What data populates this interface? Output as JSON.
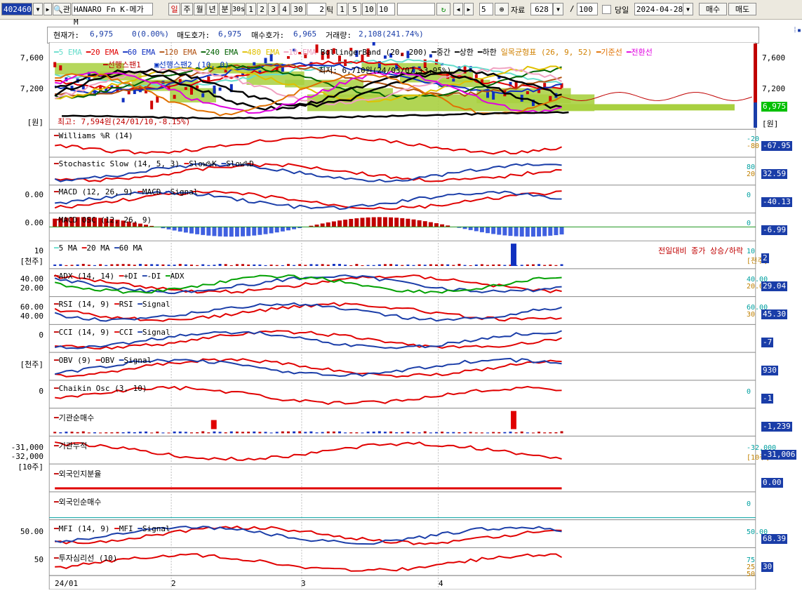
{
  "toolbar": {
    "code": "402460",
    "ticker_name": "HANARO Fn K-메가 M",
    "periods": [
      "일",
      "주",
      "월",
      "년",
      "분",
      "30s"
    ],
    "minute_steps": [
      "1",
      "2",
      "3",
      "4",
      "30"
    ],
    "tick_input": "2",
    "tick_label": "틱",
    "tick_steps": [
      "1",
      "5",
      "10",
      "10"
    ],
    "count_value": "5",
    "data_label": "자료",
    "data_count": "628",
    "ratio": "100",
    "ratio_sep": "/",
    "same_day_label": "당일",
    "date": "2024-04-28",
    "buy_label": "매수",
    "sell_label": "매도"
  },
  "info": {
    "current_label": "현재가:",
    "current": "6,975",
    "change": "0(0.00%)",
    "ask_label": "매도호가:",
    "ask": "6,975",
    "bid_label": "매수호가:",
    "bid": "6,965",
    "volume_label": "거래량:",
    "volume": "2,108(241.74%)"
  },
  "price_panel": {
    "legend": [
      {
        "text": "5 EMA",
        "color": "#66ddcc"
      },
      {
        "text": "20 EMA",
        "color": "#e00000"
      },
      {
        "text": "60 EMA",
        "color": "#1030c0"
      },
      {
        "text": "120 EMA",
        "color": "#b05010"
      },
      {
        "text": "240 EMA",
        "color": "#006000"
      },
      {
        "text": "480 EMA",
        "color": "#e0c000"
      },
      {
        "text": "10 EMA",
        "color": "#f0a0c0"
      },
      {
        "text": "BollingerBand (20, 200)",
        "color": "#000000"
      },
      {
        "text": "중간",
        "color": "#000000"
      },
      {
        "text": "상한",
        "color": "#000000"
      },
      {
        "text": "하한",
        "color": "#000000"
      },
      {
        "text": "일목균형표 (26, 9, 52)",
        "color": "#d08000"
      },
      {
        "text": "기준선",
        "color": "#e07000"
      },
      {
        "text": "전환선",
        "color": "#e000e0"
      }
    ],
    "legend2": [
      {
        "text": "선행스팬1",
        "color": "#c00000"
      },
      {
        "text": "선행스팬2",
        "color": "#0030c0"
      },
      {
        "text": "(10, 0)",
        "color": "#0030c0"
      }
    ],
    "high_note": "최고: 7,594원(24/01/10,-8.15%)",
    "low_note": "최저: 6,710원(24/03/07,+3.95%)",
    "y_ticks": [
      "7,600",
      "7,200"
    ],
    "unit": "[원]",
    "current_price": "6,975"
  },
  "panels": [
    {
      "id": "williams",
      "title": "Williams %R (14)",
      "left_ticks": [],
      "right_ticks": [
        "-20",
        "-80"
      ],
      "value": "-67.95"
    },
    {
      "id": "stoch",
      "title": "Stochastic Slow (14, 5, 3)",
      "series": [
        "Slow%K",
        "Slow%D"
      ],
      "left_ticks": [],
      "right_ticks": [
        "80",
        "20"
      ],
      "value": "32.59"
    },
    {
      "id": "macd",
      "title": "MACD (12, 26, 9)",
      "series": [
        "MACD",
        "Signal"
      ],
      "left_ticks": [
        "0.00"
      ],
      "right_ticks": [
        "0"
      ],
      "value": "-40.13"
    },
    {
      "id": "macdosc",
      "title": "MACD OSC (12, 26, 9)",
      "left_ticks": [
        "0.00"
      ],
      "right_ticks": [
        "0"
      ],
      "value": "-6.99"
    },
    {
      "id": "volume",
      "title": "5 MA",
      "series": [
        "20 MA",
        "60 MA"
      ],
      "left_ticks": [
        "10",
        "[천주]"
      ],
      "right_ticks": [
        "10",
        "[천주]"
      ],
      "value": "2",
      "note": "전일대비 종가 상승/하락"
    },
    {
      "id": "adx",
      "title": "ADX (14, 14)",
      "series": [
        "+DI",
        "-DI",
        "ADX"
      ],
      "left_ticks": [
        "40.00",
        "20.00"
      ],
      "right_ticks": [
        "40.00",
        "20.00"
      ],
      "value": "29.04"
    },
    {
      "id": "rsi",
      "title": "RSI (14, 9)",
      "series": [
        "RSI",
        "Signal"
      ],
      "left_ticks": [
        "60.00",
        "40.00"
      ],
      "right_ticks": [
        "60.00",
        "30"
      ],
      "value": "45.30"
    },
    {
      "id": "cci",
      "title": "CCI (14, 9)",
      "series": [
        "CCI",
        "Signal"
      ],
      "left_ticks": [
        "0"
      ],
      "right_ticks": [],
      "value": "-7"
    },
    {
      "id": "obv",
      "title": "OBV (9)",
      "series": [
        "OBV",
        "Signal"
      ],
      "left_ticks": [
        "[천주]"
      ],
      "right_ticks": [],
      "value": "930"
    },
    {
      "id": "chaikin",
      "title": "Chaikin Osc (3, 10)",
      "left_ticks": [
        "0"
      ],
      "right_ticks": [
        "0"
      ],
      "value": "-1"
    },
    {
      "id": "inst",
      "title": "기관순매수",
      "left_ticks": [],
      "right_ticks": [],
      "value": "-1,239"
    },
    {
      "id": "instcum",
      "title": "기관누적",
      "left_ticks": [
        "-31,000",
        "-32,000",
        "[10주]"
      ],
      "right_ticks": [
        "-32,000",
        "[10주]"
      ],
      "value": "-31,006"
    },
    {
      "id": "foreign",
      "title": "외국인지분율",
      "left_ticks": [],
      "right_ticks": [],
      "value": "0.00"
    },
    {
      "id": "foreignnet",
      "title": "외국인순매수",
      "left_ticks": [],
      "right_ticks": [
        "0"
      ],
      "value": ""
    },
    {
      "id": "mfi",
      "title": "MFI (14, 9)",
      "series": [
        "MFI",
        "Signal"
      ],
      "left_ticks": [
        "50.00"
      ],
      "right_ticks": [
        "50.00"
      ],
      "value": "68.39"
    },
    {
      "id": "psy",
      "title": "투자심리선 (10)",
      "left_ticks": [
        "50"
      ],
      "right_ticks": [
        "75",
        "25",
        "50"
      ],
      "value": "30"
    }
  ],
  "x_axis": [
    "24/01",
    "2",
    "3",
    "4"
  ]
}
